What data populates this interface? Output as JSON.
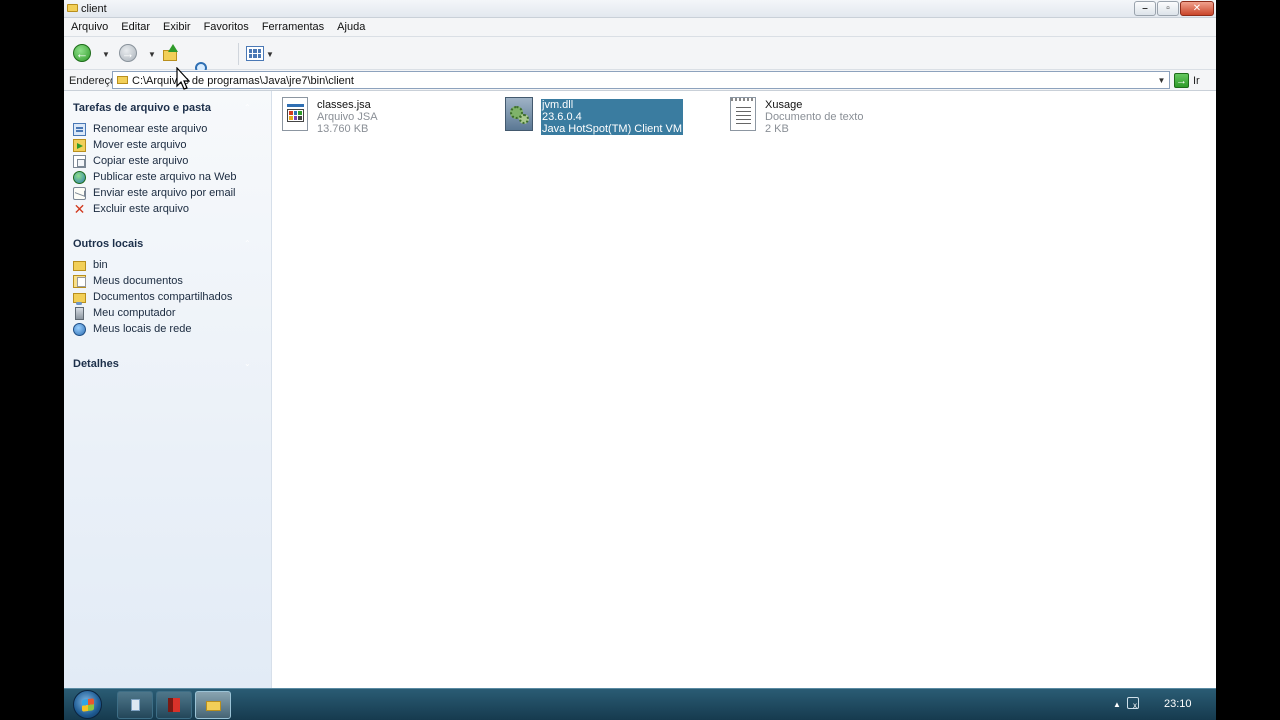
{
  "window": {
    "title": "client"
  },
  "menu": [
    "Arquivo",
    "Editar",
    "Exibir",
    "Favoritos",
    "Ferramentas",
    "Ajuda"
  ],
  "address": {
    "label": "Endereço",
    "path": "C:\\Arquivos de programas\\Java\\jre7\\bin\\client",
    "go_label": "Ir"
  },
  "tasks": {
    "title": "Tarefas de arquivo e pasta",
    "items": [
      {
        "label": "Renomear este arquivo",
        "icon": "rename-icon"
      },
      {
        "label": "Mover este arquivo",
        "icon": "move-icon"
      },
      {
        "label": "Copiar este arquivo",
        "icon": "copy-icon"
      },
      {
        "label": "Publicar este arquivo na Web",
        "icon": "web-publish-icon"
      },
      {
        "label": "Enviar este arquivo por email",
        "icon": "email-icon"
      },
      {
        "label": "Excluir este arquivo",
        "icon": "delete-icon"
      }
    ]
  },
  "places": {
    "title": "Outros locais",
    "items": [
      {
        "label": "bin",
        "icon": "folder-icon"
      },
      {
        "label": "Meus documentos",
        "icon": "my-documents-icon"
      },
      {
        "label": "Documentos compartilhados",
        "icon": "shared-folder-icon"
      },
      {
        "label": "Meu computador",
        "icon": "computer-icon"
      },
      {
        "label": "Meus locais de rede",
        "icon": "network-icon"
      }
    ]
  },
  "details": {
    "title": "Detalhes"
  },
  "files": [
    {
      "name": "classes.jsa",
      "type": "Arquivo JSA",
      "size": "13.760 KB",
      "selected": false
    },
    {
      "name": "jvm.dll",
      "type": "23.6.0.4",
      "size": "Java HotSpot(TM) Client VM",
      "selected": true
    },
    {
      "name": "Xusage",
      "type": "Documento de texto",
      "size": "2 KB",
      "selected": false
    }
  ],
  "taskbar": {
    "clock": "23:10"
  },
  "colors": {
    "selection": "#3a7ca0",
    "taskpane": "#e2ebf6",
    "taskbar": "#1f4b62"
  }
}
